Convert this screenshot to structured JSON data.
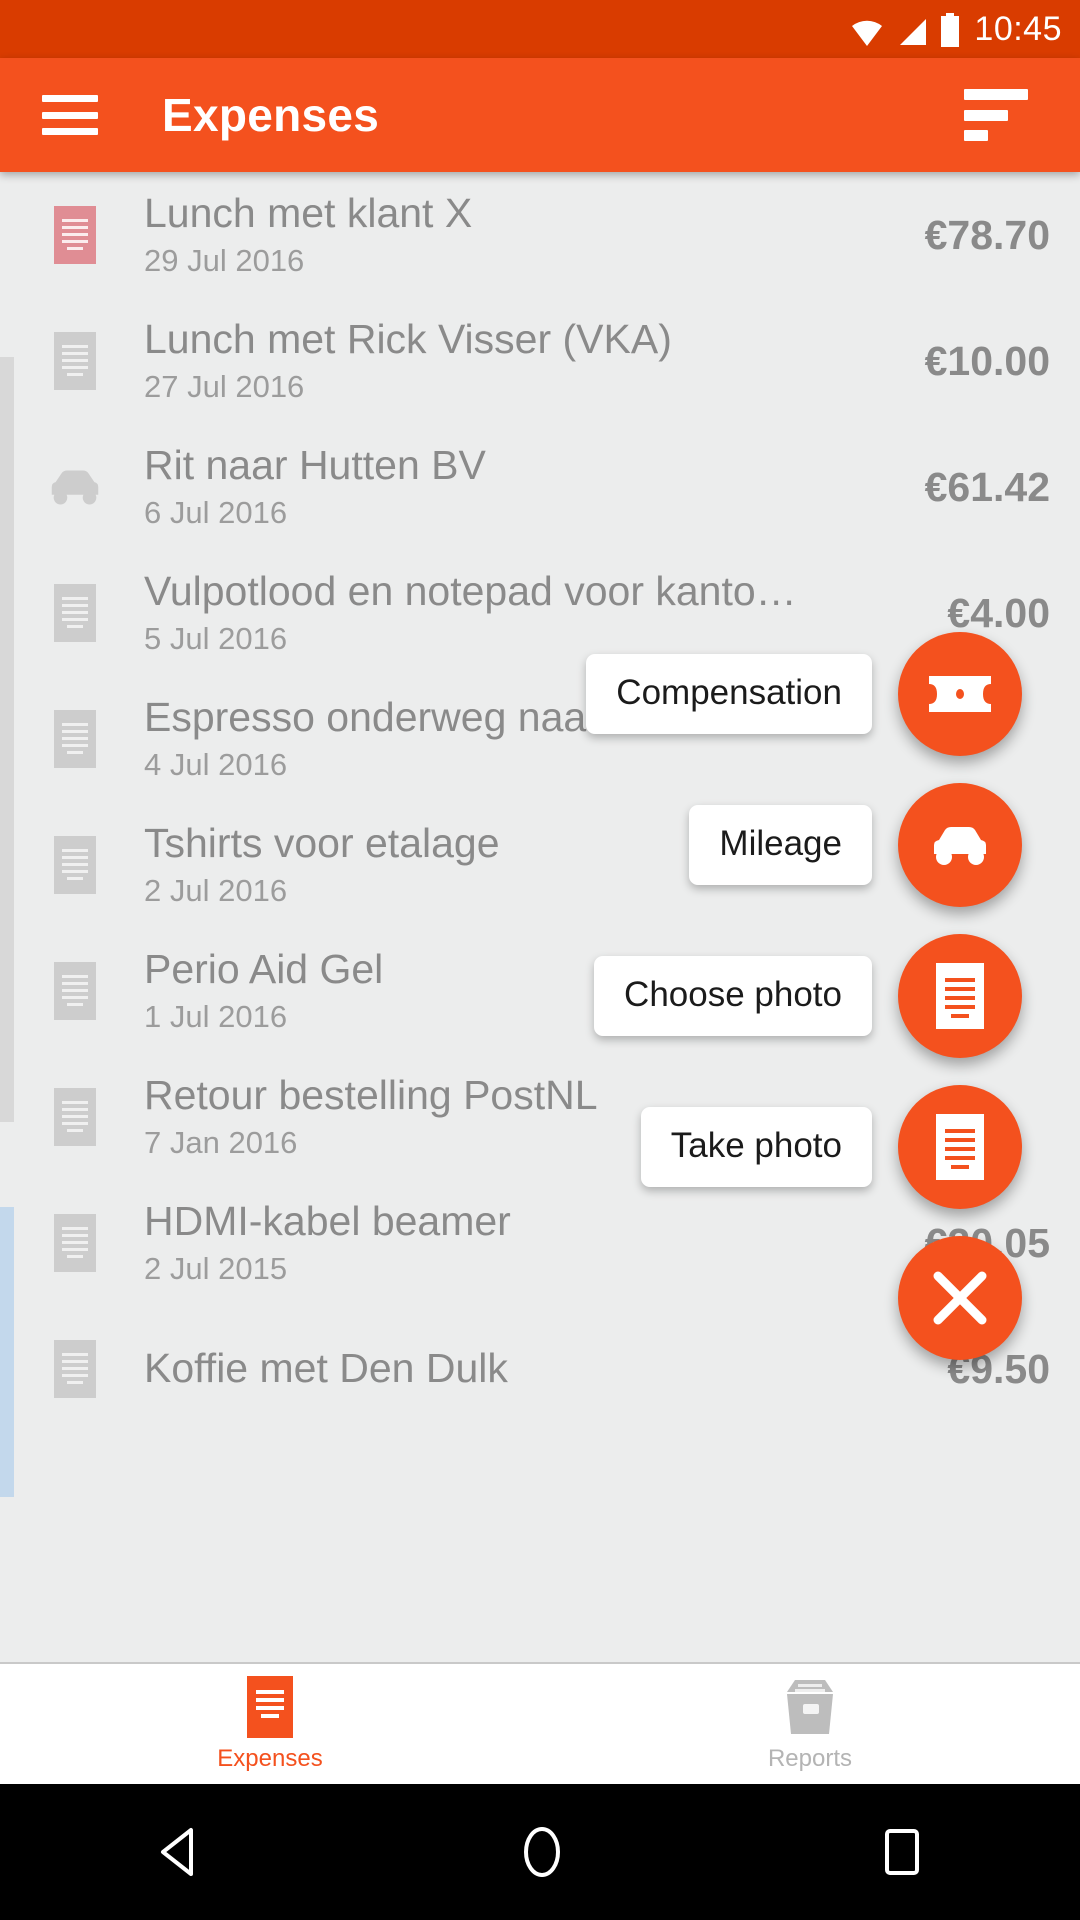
{
  "status_bar": {
    "time": "10:45",
    "icons": [
      "wifi-icon",
      "cellular-signal-icon",
      "battery-icon"
    ]
  },
  "app_bar": {
    "menu_icon": "hamburger-menu-icon",
    "title": "Expenses",
    "sort_icon": "sort-icon"
  },
  "colors": {
    "status_bar": "#d93c00",
    "app_bar": "#f4511e",
    "accent": "#f4511e",
    "list_bg": "#eceded",
    "text_primary": "#8a8a8a",
    "text_secondary": "#9c9c9c",
    "first_row_icon": "#e08d94",
    "scroll_indicator": "#d8d8d8",
    "edge_strip": "#c3d8ec"
  },
  "expenses": [
    {
      "icon": "receipt-icon-pink",
      "title": "Lunch met klant X",
      "date": "29 Jul 2016",
      "amount": "€78.70"
    },
    {
      "icon": "receipt-icon",
      "title": "Lunch met Rick Visser (VKA)",
      "date": "27 Jul 2016",
      "amount": "€10.00"
    },
    {
      "icon": "car-icon",
      "title": "Rit naar Hutten BV",
      "date": "6 Jul 2016",
      "amount": "€61.42"
    },
    {
      "icon": "receipt-icon",
      "title": "Vulpotlood en notepad voor kanto…",
      "date": "5 Jul 2016",
      "amount": "€4.00"
    },
    {
      "icon": "receipt-icon",
      "title": "Espresso onderweg naar De Baak",
      "date": "4 Jul 2016",
      "amount": ""
    },
    {
      "icon": "receipt-icon",
      "title": "Tshirts voor etalage",
      "date": "2 Jul 2016",
      "amount": ""
    },
    {
      "icon": "receipt-icon",
      "title": "Perio Aid Gel",
      "date": "1 Jul 2016",
      "amount": ""
    },
    {
      "icon": "receipt-icon",
      "title": "Retour bestelling PostNL",
      "date": "7 Jan 2016",
      "amount": ""
    },
    {
      "icon": "receipt-icon",
      "title": "HDMI-kabel beamer",
      "date": "2 Jul 2015",
      "amount": "€20.05"
    },
    {
      "icon": "receipt-icon",
      "title": "Koffie met Den Dulk",
      "date": "",
      "amount": "€9.50"
    }
  ],
  "fab_menu": {
    "expanded": true,
    "items": [
      {
        "label": "Compensation",
        "icon": "banknote-icon"
      },
      {
        "label": "Mileage",
        "icon": "car-icon"
      },
      {
        "label": "Choose photo",
        "icon": "receipt-icon"
      },
      {
        "label": "Take photo",
        "icon": "receipt-icon"
      }
    ],
    "close_icon": "close-icon"
  },
  "bottom_nav": {
    "tabs": [
      {
        "label": "Expenses",
        "icon": "receipt-icon",
        "active": true
      },
      {
        "label": "Reports",
        "icon": "archive-box-icon",
        "active": false
      }
    ]
  },
  "android_nav": {
    "back_icon": "back-triangle-icon",
    "home_icon": "home-circle-icon",
    "recents_icon": "recents-square-icon"
  }
}
